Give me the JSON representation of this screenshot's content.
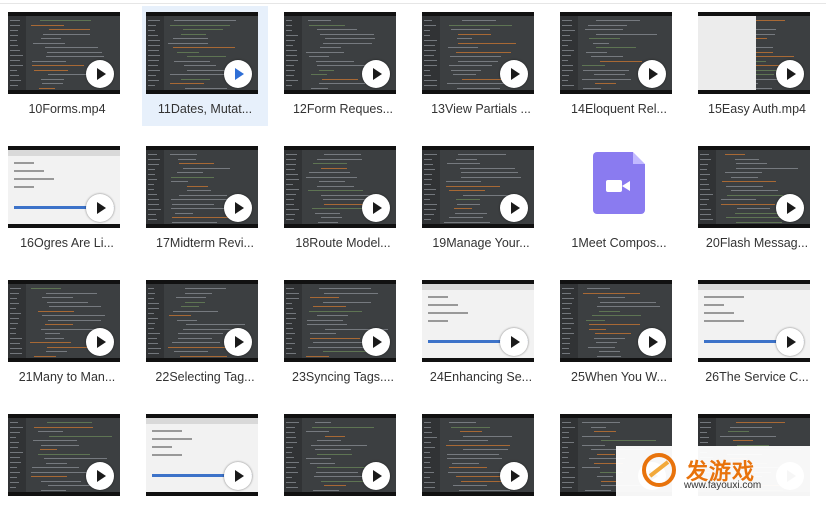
{
  "files": [
    {
      "name": "10Forms.mp4",
      "kind": "video",
      "style": "code"
    },
    {
      "name": "11Dates, Mutat...",
      "kind": "video",
      "style": "code",
      "selected": true
    },
    {
      "name": "12Form Reques...",
      "kind": "video",
      "style": "code"
    },
    {
      "name": "13View Partials ...",
      "kind": "video",
      "style": "code"
    },
    {
      "name": "14Eloquent Rel...",
      "kind": "video",
      "style": "code"
    },
    {
      "name": "15Easy Auth.mp4",
      "kind": "video",
      "style": "mixed"
    },
    {
      "name": "16Ogres Are Li...",
      "kind": "video",
      "style": "light"
    },
    {
      "name": "17Midterm Revi...",
      "kind": "video",
      "style": "code"
    },
    {
      "name": "18Route Model...",
      "kind": "video",
      "style": "code"
    },
    {
      "name": "19Manage Your...",
      "kind": "video",
      "style": "code"
    },
    {
      "name": "1Meet Compos...",
      "kind": "video-file-icon",
      "style": "icon"
    },
    {
      "name": "20Flash Messag...",
      "kind": "video",
      "style": "code"
    },
    {
      "name": "21Many to Man...",
      "kind": "video",
      "style": "code"
    },
    {
      "name": "22Selecting Tag...",
      "kind": "video",
      "style": "code"
    },
    {
      "name": "23Syncing Tags....",
      "kind": "video",
      "style": "code"
    },
    {
      "name": "24Enhancing Se...",
      "kind": "video",
      "style": "light"
    },
    {
      "name": "25When You W...",
      "kind": "video",
      "style": "code"
    },
    {
      "name": "26The Service C...",
      "kind": "video",
      "style": "light"
    },
    {
      "name": "",
      "kind": "video",
      "style": "code"
    },
    {
      "name": "",
      "kind": "video",
      "style": "light"
    },
    {
      "name": "",
      "kind": "video",
      "style": "code"
    },
    {
      "name": "",
      "kind": "video",
      "style": "code"
    },
    {
      "name": "",
      "kind": "video",
      "style": "code"
    },
    {
      "name": "",
      "kind": "video",
      "style": "code"
    }
  ],
  "watermark": {
    "logo_text": "发游戏",
    "url": "www.fayouxi.com",
    "color": "#e8730c"
  },
  "colors": {
    "selection": "#e7f0fb",
    "video_icon": "#8a7bf0"
  }
}
